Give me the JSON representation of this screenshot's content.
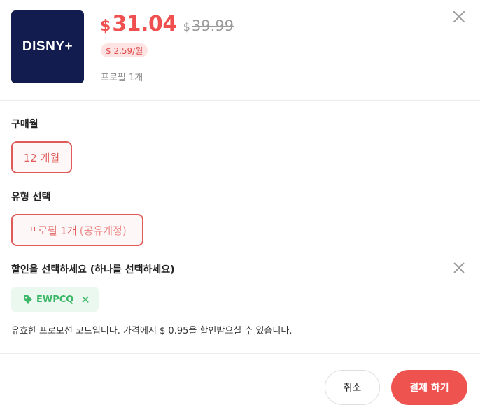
{
  "product": {
    "logo_text": "DISNY+",
    "currency": "$",
    "price": "31.04",
    "original_currency": "$",
    "original_price": "39.99",
    "monthly_price": "$ 2.59/월",
    "profile_note": "프로필 1개"
  },
  "months": {
    "label": "구매월",
    "selected": "12 개월"
  },
  "type": {
    "label": "유형 선택",
    "selected_main": "프로필 1개",
    "selected_sub": "(공유계정)"
  },
  "discount": {
    "label": "할인을 선택하세요 (하나를 선택하세요)",
    "coupon_code": "EWPCQ",
    "remove_symbol": "✕",
    "message": "유효한 프로모션 코드입니다. 가격에서 $ 0.95을 할인받으실 수 있습니다."
  },
  "actions": {
    "cancel": "취소",
    "pay": "결제 하기"
  },
  "colors": {
    "accent": "#ef5350",
    "logo_bg": "#131c4f",
    "coupon_green": "#3cb868"
  }
}
